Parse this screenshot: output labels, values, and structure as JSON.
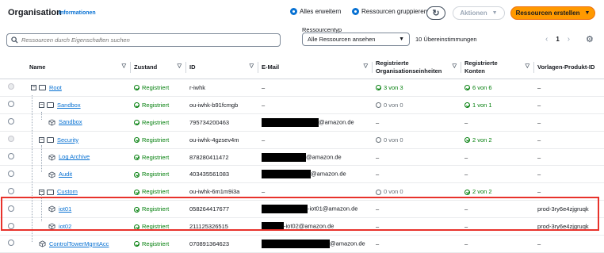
{
  "header": {
    "title": "Organisation",
    "info_link": "Informationen",
    "toggle_expand": "Alles erweitern",
    "toggle_group": "Ressourcen gruppieren",
    "refresh_icon": "refresh-icon",
    "actions_label": "Aktionen",
    "create_label": "Ressourcen erstellen"
  },
  "filter": {
    "search_placeholder": "Ressourcen durch Eigenschaften suchen",
    "resource_type_label": "Ressourcentyp",
    "resource_type_value": "Alle Ressourcen ansehen",
    "match_count": "10 Übereinstimmungen",
    "page": "1"
  },
  "columns": {
    "name": "Name",
    "state": "Zustand",
    "id": "ID",
    "email": "E-Mail",
    "ou": "Registrierte Organisationseinheiten",
    "accounts": "Registrierte Konten",
    "product": "Vorlagen-Produkt-ID"
  },
  "rows": [
    {
      "name": "Root",
      "type": "ou",
      "level": 0,
      "state": "Registriert",
      "id": "r-iwhk",
      "email_suffix": "–",
      "ou": "3 von 3",
      "ou_ok": true,
      "acc": "6 von 6",
      "acc_ok": true,
      "product": "–",
      "disabled": true
    },
    {
      "name": "Sandbox",
      "type": "ou",
      "level": 1,
      "state": "Registriert",
      "id": "ou-iwhk-b91fcmgb",
      "email_suffix": "–",
      "ou": "0 von 0",
      "ou_ok": false,
      "acc": "1 von 1",
      "acc_ok": true,
      "product": "–",
      "disabled": false
    },
    {
      "name": "Sandbox",
      "type": "account",
      "level": 2,
      "state": "Registriert",
      "id": "795734200463",
      "email_suffix": "@amazon.de",
      "ou": "–",
      "acc": "–",
      "product": "–",
      "disabled": false
    },
    {
      "name": "Security",
      "type": "ou",
      "level": 1,
      "state": "Registriert",
      "id": "ou-iwhk-4gzsev4m",
      "email_suffix": "–",
      "ou": "0 von 0",
      "ou_ok": false,
      "acc": "2 von 2",
      "acc_ok": true,
      "product": "–",
      "disabled": true
    },
    {
      "name": "Log Archive",
      "type": "account",
      "level": 2,
      "state": "Registriert",
      "id": "878280411472",
      "email_suffix": "@amazon.de",
      "ou": "–",
      "acc": "–",
      "product": "–",
      "disabled": false
    },
    {
      "name": "Audit",
      "type": "account",
      "level": 2,
      "state": "Registriert",
      "id": "403435561083",
      "email_suffix": "@amazon.de",
      "ou": "–",
      "acc": "–",
      "product": "–",
      "disabled": false
    },
    {
      "name": "Custom",
      "type": "ou",
      "level": 1,
      "state": "Registriert",
      "id": "ou-iwhk-6m1m9i3a",
      "email_suffix": "–",
      "ou": "0 von 0",
      "ou_ok": false,
      "acc": "2 von 2",
      "acc_ok": true,
      "product": "–",
      "disabled": false
    },
    {
      "name": "iot01",
      "type": "account",
      "level": 2,
      "state": "Registriert",
      "id": "058264417677",
      "email_suffix": "-iot01@amazon.de",
      "ou": "–",
      "acc": "–",
      "product": "prod-3ry6e4zjgruqk",
      "disabled": false
    },
    {
      "name": "iot02",
      "type": "account",
      "level": 2,
      "state": "Registriert",
      "id": "211125326515",
      "email_suffix": "-iot02@amazon.de",
      "ou": "–",
      "acc": "–",
      "product": "prod-3ry6e4zjgruqk",
      "disabled": false
    },
    {
      "name": "ControlTowerMgmtAcc",
      "type": "account",
      "level": 1,
      "state": "Registriert",
      "id": "070891364623",
      "email_suffix": "@amazon.de",
      "ou": "–",
      "acc": "–",
      "product": "–",
      "disabled": false
    }
  ],
  "colors": {
    "link": "#0972d3",
    "success": "#037f0c",
    "primary": "#ff9900",
    "highlight": "#e8322b"
  }
}
